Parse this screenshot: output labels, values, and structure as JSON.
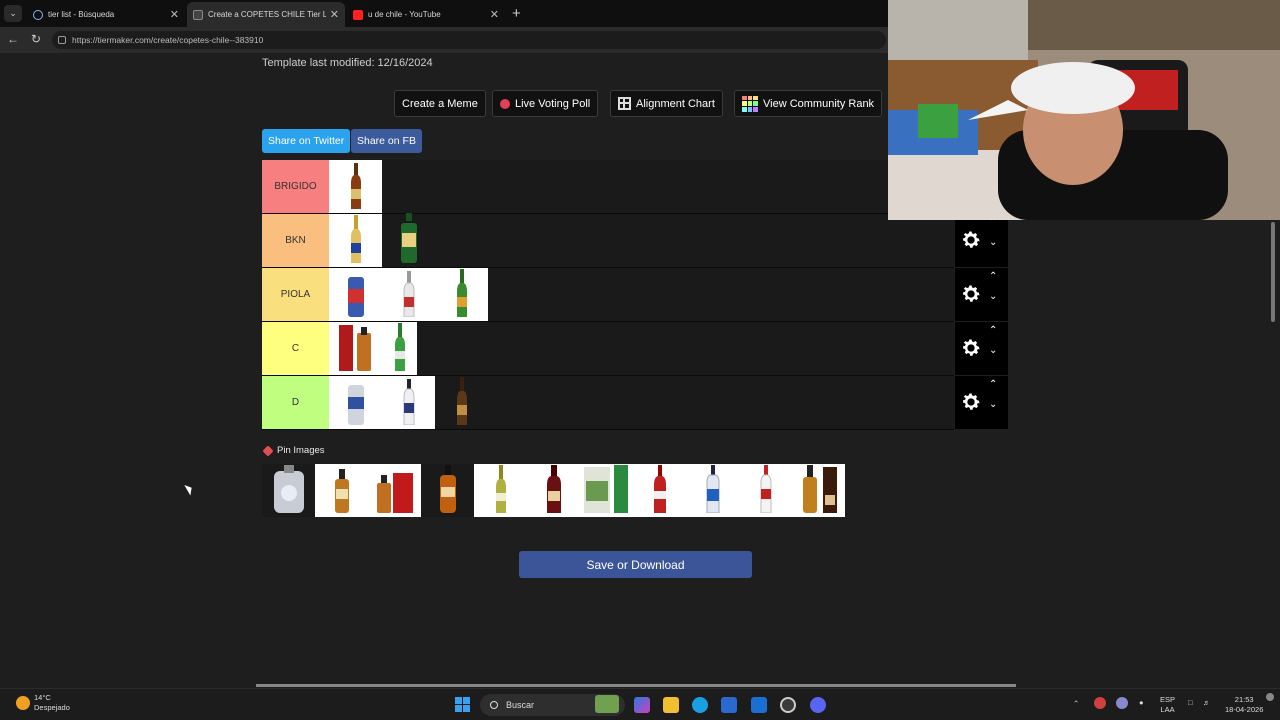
{
  "browser": {
    "tabs": [
      {
        "label": "tier list - Búsqueda",
        "active": false
      },
      {
        "label": "Create a COPETES CHILE Tier List",
        "active": true
      },
      {
        "label": "u de chile - YouTube",
        "active": false
      }
    ],
    "url": "https://tiermaker.com/create/copetes-chile--383910"
  },
  "page": {
    "modified": "Template last modified: 12/16/2024",
    "toolbar": {
      "meme": "Create a Meme",
      "poll": "Live Voting Poll",
      "alignment": "Alignment Chart",
      "community": "View Community Rank"
    },
    "share": {
      "twitter": "Share on Twitter",
      "fb": "Share on FB"
    },
    "tiers": [
      {
        "label": "BRIGIDO",
        "color": "#f87f7f",
        "items": [
          "amber"
        ]
      },
      {
        "label": "BKN",
        "color": "#fabe7f",
        "items": [
          "clear-beer",
          "green-jager"
        ]
      },
      {
        "label": "PIOLA",
        "color": "#fadf7f",
        "items": [
          "can-blue",
          "white-rum",
          "green-beer"
        ]
      },
      {
        "label": "C",
        "color": "#fefe7f",
        "items": [
          "whisky-red",
          "green-glass"
        ]
      },
      {
        "label": "D",
        "color": "#c0fe7f",
        "items": [
          "can-silver",
          "vodka-clear",
          "dark-beer"
        ]
      }
    ],
    "pin_label": "Pin Images",
    "save": "Save or Download"
  },
  "taskbar": {
    "temp": "14°C",
    "weather": "Despejado",
    "search": "Buscar",
    "lang1": "ESP",
    "lang2": "LAA",
    "time": "21:53",
    "date": "18-04-2026"
  },
  "colors": {
    "twitter": "#2ba2ed",
    "fb": "#3b5b9d",
    "save": "#3b5598"
  }
}
